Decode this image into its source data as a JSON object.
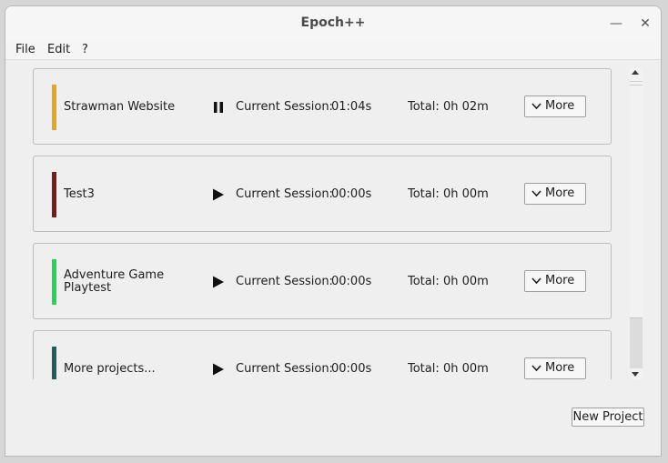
{
  "window": {
    "title": "Epoch++",
    "minimize_glyph": "—",
    "close_glyph": "✕"
  },
  "menu": {
    "file": "File",
    "edit": "Edit",
    "help": "?"
  },
  "projects": [
    {
      "name": "Strawman Website",
      "color": "#e6a817",
      "state": "pause-icon",
      "session_label": "Current Session:",
      "session_value": "01:04s",
      "total_label": "Total:",
      "total_value": "0h 02m",
      "more_label": "More"
    },
    {
      "name": "Test3",
      "color": "#7a1a1a",
      "state": "play-icon",
      "session_label": "Current Session:",
      "session_value": "00:00s",
      "total_label": "Total:",
      "total_value": "0h 00m",
      "more_label": "More"
    },
    {
      "name": "Adventure Game Playtest",
      "color": "#1fd655",
      "state": "play-icon",
      "session_label": "Current Session:",
      "session_value": "00:00s",
      "total_label": "Total:",
      "total_value": "0h 00m",
      "more_label": "More"
    },
    {
      "name": "More projects...",
      "color": "#215f5a",
      "state": "play-icon",
      "session_label": "Current Session:",
      "session_value": "00:00s",
      "total_label": "Total:",
      "total_value": "0h 00m",
      "more_label": "More"
    }
  ],
  "footer": {
    "new_project_label": "New Project"
  }
}
